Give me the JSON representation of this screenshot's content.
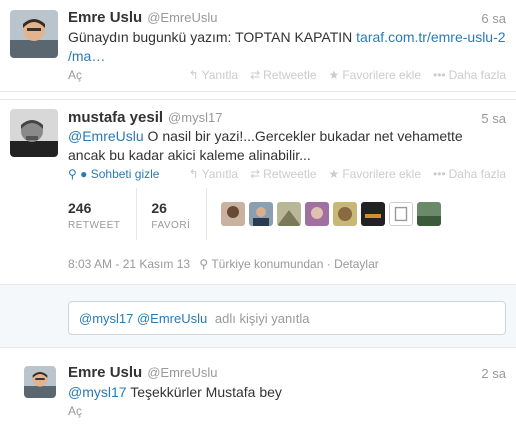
{
  "tweet1": {
    "name": "Emre Uslu",
    "handle": "@EmreUslu",
    "time": "6 sa",
    "text_prefix": "Günaydın bugunkü yazım: TOPTAN KAPATIN ",
    "link_line1": "taraf.com.tr/emre-uslu-2",
    "link_line2": "/ma…",
    "expand": "Aç",
    "actions": [
      "Yanıtla",
      "Retweetle",
      "Favorilere ekle",
      "Daha fazla"
    ]
  },
  "tweet2": {
    "name": "mustafa yesil",
    "handle": "@mysl17",
    "time": "5 sa",
    "mention": "@EmreUslu",
    "text_line1": " O nasil bir yazi!...Gercekler bukadar net vehamette",
    "text_line2": "ancak bu kadar akici kaleme alinabilir...",
    "hide_conversation": "Sohbeti gizle",
    "actions": [
      "Yanıtla",
      "Retweetle",
      "Favorilere ekle",
      "Daha fazla"
    ],
    "retweets": "246",
    "retweets_label": "RETWEET",
    "favorites": "26",
    "favorites_label": "FAVORİ",
    "timestamp": "8:03 AM - 21 Kasım 13",
    "location": "Türkiye konumundan",
    "separator": "·",
    "details": "Detaylar"
  },
  "reply": {
    "prefill": "@mysl17 @EmreUslu",
    "hint": "adlı kişiyi yanıtla"
  },
  "tweet3": {
    "name": "Emre Uslu",
    "handle": "@EmreUslu",
    "time": "2 sa",
    "mention": "@mysl17",
    "text": " Teşekkürler Mustafa bey",
    "expand": "Aç"
  },
  "colors": {
    "link": "#2a7ab5",
    "muted": "#999999",
    "action": "#cccccc"
  }
}
